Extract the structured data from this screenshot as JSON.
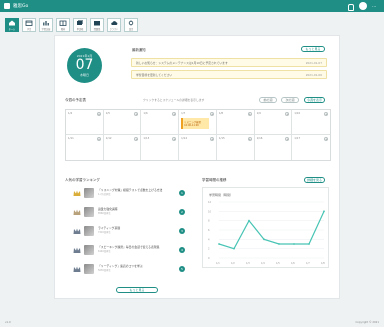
{
  "app": {
    "title": "雅思Go",
    "user": "···",
    "accent": "#1f8f86"
  },
  "nav": [
    {
      "label": "ホーム",
      "icon": "home-icon"
    },
    {
      "label": "予定",
      "icon": "calendar-icon"
    },
    {
      "label": "学習記録",
      "icon": "chart-icon"
    },
    {
      "label": "教材",
      "icon": "book-icon"
    },
    {
      "label": "単語帳",
      "icon": "cards-icon"
    },
    {
      "label": "問題集",
      "icon": "list-icon"
    },
    {
      "label": "クラウド",
      "icon": "cloud-icon"
    },
    {
      "label": "設定",
      "icon": "gear-icon"
    }
  ],
  "date": {
    "top": "2021年1月",
    "day": "07",
    "week": "木曜日"
  },
  "notice": {
    "title": "最新通知",
    "more": "もっと見る",
    "items": [
      {
        "text": "新しいお知らせ：システムのメンテナンスは1月10日に予定されています",
        "date": "2021-01-07"
      },
      {
        "text": "学習目標を更新してください",
        "date": "2021-01-06"
      }
    ]
  },
  "calendar": {
    "title": "今週の予定表",
    "note": "クリックするとスケジュールの詳細を表示します",
    "prev": "前の週",
    "next": "次の週",
    "this_week": "今週を表示",
    "row1": [
      "1/4",
      "1/5",
      "1/6",
      "1/7",
      "1/8",
      "1/9",
      "1/10"
    ],
    "row2": [
      "1/11",
      "1/12",
      "1/13",
      "1/14",
      "1/15",
      "1/16",
      "1/17"
    ],
    "event": "リスニング練習 10:00-11:00"
  },
  "ranking": {
    "title": "人気の学習ランキング",
    "items": [
      {
        "title": "「リスニング対策」模擬テストで点数を上げる方法",
        "sub": "1.2万回再生",
        "badge": "1"
      },
      {
        "title": "語彙力強化講座",
        "sub": "8560回再生",
        "badge": "2"
      },
      {
        "title": "ライティング基礎",
        "sub": "7210回再生",
        "badge": "3"
      },
      {
        "title": "「スピーキング練習」毎日の会話で使える表現集",
        "sub": "6140回再生",
        "badge": "4"
      },
      {
        "title": "「リーディング」速読のコツを学ぶ",
        "sub": "5030回再生",
        "badge": "5"
      }
    ],
    "more": "もっと見る"
  },
  "chart": {
    "title": "学習時間の推移",
    "label": "学習時間（時間）",
    "button": "詳細を見る"
  },
  "chart_data": {
    "type": "line",
    "title": "学習時間の推移",
    "categories": [
      "1/1",
      "1/2",
      "1/3",
      "1/4",
      "1/5",
      "1/6",
      "1/7",
      "1/8"
    ],
    "values": [
      3,
      2,
      8,
      4,
      3,
      3,
      3,
      10
    ],
    "xlabel": "",
    "ylabel": "学習時間（時間）",
    "ylim": [
      0,
      12
    ],
    "grid": true,
    "color": "#47c4b4"
  },
  "footer": {
    "left": "v1.0",
    "right": "Copyright © 2021"
  }
}
